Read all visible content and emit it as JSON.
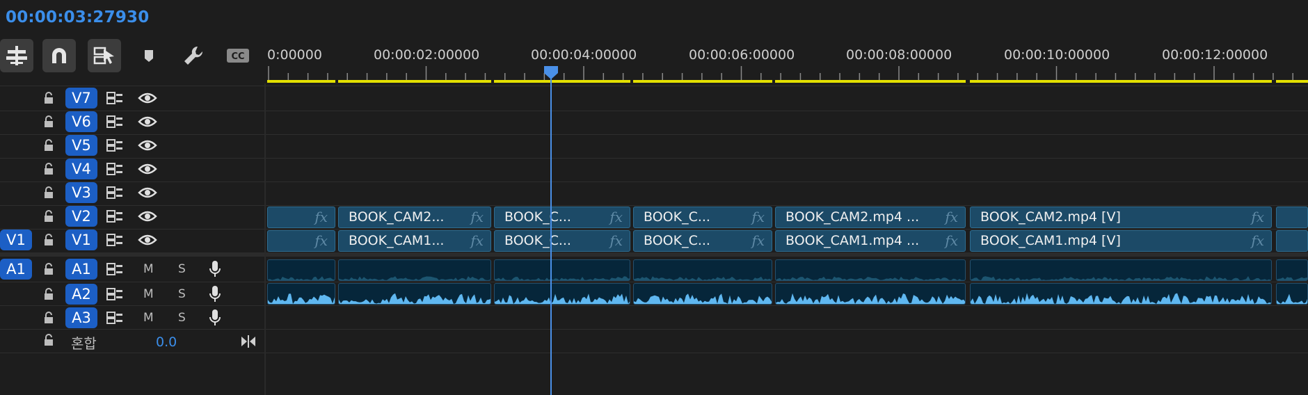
{
  "timecode": "00:00:03:27930",
  "toolbar": {
    "tools": [
      {
        "name": "insert-tracks-tool",
        "active": true
      },
      {
        "name": "snap-magnet-tool",
        "active": true
      },
      {
        "name": "linked-selection-tool",
        "active": true
      },
      {
        "name": "add-marker-tool",
        "active": false
      },
      {
        "name": "settings-wrench-tool",
        "active": false
      },
      {
        "name": "captions-cc-tool",
        "active": false
      }
    ]
  },
  "ruler": {
    "labels": [
      "0:00000",
      "00:00:02:00000",
      "00:00:04:00000",
      "00:00:06:00000",
      "00:00:08:00000",
      "00:00:10:00000",
      "00:00:12:00000"
    ]
  },
  "playhead": {
    "timecode": "00:00:03:27930"
  },
  "video_tracks": [
    {
      "label": "V7",
      "source": ""
    },
    {
      "label": "V6",
      "source": ""
    },
    {
      "label": "V5",
      "source": ""
    },
    {
      "label": "V4",
      "source": ""
    },
    {
      "label": "V3",
      "source": ""
    },
    {
      "label": "V2",
      "source": ""
    },
    {
      "label": "V1",
      "source": "V1"
    }
  ],
  "audio_tracks": [
    {
      "label": "A1",
      "source": "A1",
      "m": "M",
      "s": "S"
    },
    {
      "label": "A2",
      "source": "",
      "m": "M",
      "s": "S"
    },
    {
      "label": "A3",
      "source": "",
      "m": "M",
      "s": "S"
    }
  ],
  "mix": {
    "label": "혼합",
    "value": "0.0"
  },
  "clips": {
    "v2": [
      "",
      "BOOK_CAM2...",
      "BOOK_C...",
      "BOOK_C...",
      "BOOK_CAM2.mp4 ...",
      "BOOK_CAM2.mp4 [V]",
      ""
    ],
    "v1": [
      "",
      "BOOK_CAM1...",
      "BOOK_C...",
      "BOOK_C...",
      "BOOK_CAM1.mp4 ...",
      "BOOK_CAM1.mp4 [V]",
      ""
    ],
    "fx": "fx"
  },
  "colors": {
    "accent": "#3b8eea",
    "track_badge": "#1c5fc5",
    "video_clip": "#1c4a67",
    "audio_wave": "#5fb7f0",
    "work_area": "#e3e000"
  }
}
